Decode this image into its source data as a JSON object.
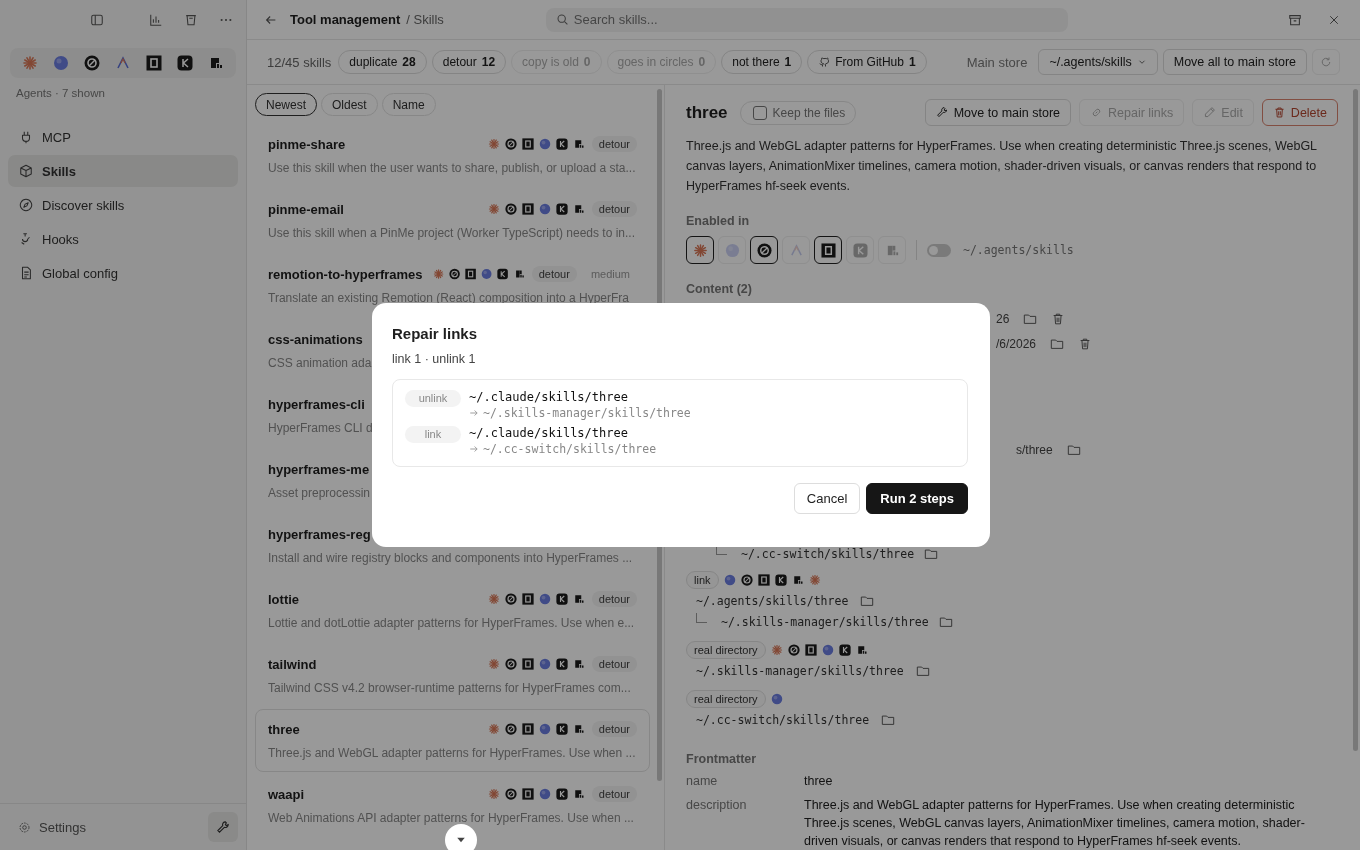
{
  "sidebar": {
    "agents": [
      {
        "kind": "asterisk"
      },
      {
        "kind": "blob"
      },
      {
        "kind": "ring"
      },
      {
        "kind": "chevron"
      },
      {
        "kind": "square"
      },
      {
        "kind": "tile"
      },
      {
        "kind": "pixel"
      }
    ],
    "agents_caption": "Agents · 7 shown",
    "items": [
      {
        "label": "MCP",
        "selected": false
      },
      {
        "label": "Skills",
        "selected": true
      },
      {
        "label": "Discover skills",
        "selected": false
      },
      {
        "label": "Hooks",
        "selected": false
      },
      {
        "label": "Global config",
        "selected": false
      }
    ],
    "settings": "Settings"
  },
  "header": {
    "title": "Tool management",
    "crumb": "/ Skills",
    "search": {
      "placeholder": "Search skills..."
    }
  },
  "toolbar": {
    "count": "12/45 skills",
    "filters": [
      {
        "label": "duplicate",
        "count": "28",
        "disabled": false
      },
      {
        "label": "detour",
        "count": "12",
        "disabled": false
      },
      {
        "label": "copy is old",
        "count": "0",
        "disabled": true
      },
      {
        "label": "goes in circles",
        "count": "0",
        "disabled": true
      },
      {
        "label": "not there",
        "count": "1",
        "disabled": false
      },
      {
        "label": "From GitHub",
        "count": "1",
        "disabled": false,
        "kind": "github"
      }
    ],
    "store_label": "Main store",
    "store_value": "~/.agents/skills",
    "move_all": "Move all to main store"
  },
  "sort": [
    {
      "label": "Newest",
      "selected": true
    },
    {
      "label": "Oldest",
      "selected": false
    },
    {
      "label": "Name",
      "selected": false
    }
  ],
  "skills": [
    {
      "name": "pinme-share",
      "agents": [
        {
          "kind": "asterisk"
        },
        {
          "kind": "ring"
        },
        {
          "kind": "square"
        },
        {
          "kind": "blob"
        },
        {
          "kind": "tile"
        },
        {
          "kind": "pixel"
        }
      ],
      "tags": [
        "detour"
      ],
      "description": "Use this skill when the user wants to share, publish, or upload a sta...",
      "selected": false
    },
    {
      "name": "pinme-email",
      "agents": [
        {
          "kind": "asterisk"
        },
        {
          "kind": "ring"
        },
        {
          "kind": "square"
        },
        {
          "kind": "blob"
        },
        {
          "kind": "tile"
        },
        {
          "kind": "pixel"
        }
      ],
      "tags": [
        "detour"
      ],
      "description": "Use this skill when a PinMe project (Worker TypeScript) needs to in...",
      "selected": false
    },
    {
      "name": "remotion-to-hyperframes",
      "agents": [
        {
          "kind": "asterisk"
        },
        {
          "kind": "ring"
        },
        {
          "kind": "square"
        },
        {
          "kind": "blob"
        },
        {
          "kind": "tile"
        },
        {
          "kind": "pixel"
        }
      ],
      "tags": [
        "detour",
        "medium"
      ],
      "description": "Translate an existing Remotion (React) composition into a HyperFra",
      "selected": false
    },
    {
      "name": "css-animations",
      "description": "CSS animation ada",
      "selected": false
    },
    {
      "name": "hyperframes-cli",
      "description": "HyperFrames CLI d",
      "selected": false
    },
    {
      "name": "hyperframes-me",
      "description": "Asset preprocessin",
      "selected": false
    },
    {
      "name": "hyperframes-reg",
      "description": "Install and wire registry blocks and components into HyperFrames ...",
      "selected": false
    },
    {
      "name": "lottie",
      "agents": [
        {
          "kind": "asterisk"
        },
        {
          "kind": "ring"
        },
        {
          "kind": "square"
        },
        {
          "kind": "blob"
        },
        {
          "kind": "tile"
        },
        {
          "kind": "pixel"
        }
      ],
      "tags": [
        "detour"
      ],
      "description": "Lottie and dotLottie adapter patterns for HyperFrames. Use when e...",
      "selected": false
    },
    {
      "name": "tailwind",
      "agents": [
        {
          "kind": "asterisk"
        },
        {
          "kind": "ring"
        },
        {
          "kind": "square"
        },
        {
          "kind": "blob"
        },
        {
          "kind": "tile"
        },
        {
          "kind": "pixel"
        }
      ],
      "tags": [
        "detour"
      ],
      "description": "Tailwind CSS v4.2 browser-runtime patterns for HyperFrames com...",
      "selected": false
    },
    {
      "name": "three",
      "agents": [
        {
          "kind": "asterisk"
        },
        {
          "kind": "ring"
        },
        {
          "kind": "square"
        },
        {
          "kind": "blob"
        },
        {
          "kind": "tile"
        },
        {
          "kind": "pixel"
        }
      ],
      "tags": [
        "detour"
      ],
      "description": "Three.js and WebGL adapter patterns for HyperFrames. Use when ...",
      "selected": true
    },
    {
      "name": "waapi",
      "agents": [
        {
          "kind": "asterisk"
        },
        {
          "kind": "ring"
        },
        {
          "kind": "square"
        },
        {
          "kind": "blob"
        },
        {
          "kind": "tile"
        },
        {
          "kind": "pixel"
        }
      ],
      "tags": [
        "detour"
      ],
      "description": "Web Animations API adapter patterns for HyperFrames. Use when ...",
      "selected": false
    }
  ],
  "detail": {
    "title": "three",
    "keep_files": {
      "label": "Keep the files",
      "checked": false
    },
    "actions": [
      {
        "label": "Move to main store",
        "disabled": false,
        "kind": "normal"
      },
      {
        "label": "Repair links",
        "disabled": true,
        "kind": "normal"
      },
      {
        "label": "Edit",
        "disabled": true,
        "kind": "normal"
      },
      {
        "label": "Delete",
        "disabled": false,
        "kind": "danger"
      }
    ],
    "description": "Three.js and WebGL adapter patterns for HyperFrames. Use when creating deterministic Three.js scenes, WebGL canvas layers, AnimationMixer timelines, camera motion, shader-driven visuals, or canvas renders that respond to HyperFrames hf-seek events.",
    "enabled_label": "Enabled in",
    "enabled_in": [
      {
        "kind": "asterisk",
        "on": true
      },
      {
        "kind": "blob",
        "on": false
      },
      {
        "kind": "ring",
        "on": true
      },
      {
        "kind": "chevron",
        "on": false
      },
      {
        "kind": "square",
        "on": true
      },
      {
        "kind": "tile",
        "on": false
      },
      {
        "kind": "pixel",
        "on": false
      }
    ],
    "store_toggle": {
      "on": false,
      "label": "~/.agents/skills"
    },
    "content_label": "Content (2)",
    "tails": [
      {
        "text": "26",
        "trash": true
      },
      {
        "text": "/6/2026",
        "trash": true
      },
      {
        "text": "s/three",
        "trash": false
      }
    ],
    "tail_child": "~/.cc-switch/skills/three",
    "groups": [
      {
        "badge": "link",
        "agents": [
          {
            "kind": "blob"
          },
          {
            "kind": "ring"
          },
          {
            "kind": "square"
          },
          {
            "kind": "tile"
          },
          {
            "kind": "pixel"
          },
          {
            "kind": "asterisk"
          }
        ],
        "path": "~/.agents/skills/three",
        "child": "~/.skills-manager/skills/three"
      },
      {
        "badge": "real directory",
        "agents": [
          {
            "kind": "asterisk"
          },
          {
            "kind": "ring"
          },
          {
            "kind": "square"
          },
          {
            "kind": "blob"
          },
          {
            "kind": "tile"
          },
          {
            "kind": "pixel"
          }
        ],
        "path": "~/.skills-manager/skills/three"
      },
      {
        "badge": "real directory",
        "agents": [
          {
            "kind": "blob"
          }
        ],
        "path": "~/.cc-switch/skills/three"
      }
    ],
    "frontmatter_label": "Frontmatter",
    "frontmatter": [
      {
        "key": "name",
        "value": "three"
      },
      {
        "key": "description",
        "value": "Three.js and WebGL adapter patterns for HyperFrames. Use when creating deterministic Three.js scenes, WebGL canvas layers, AnimationMixer timelines, camera motion, shader-driven visuals, or canvas renders that respond to HyperFrames hf-seek events."
      }
    ]
  },
  "dialog": {
    "title": "Repair links",
    "summary": "link 1 · unlink 1",
    "steps": [
      {
        "action": "unlink",
        "source": "~/.claude/skills/three",
        "target": "~/.skills-manager/skills/three"
      },
      {
        "action": "link",
        "source": "~/.claude/skills/three",
        "target": "~/.cc-switch/skills/three"
      }
    ],
    "cancel": "Cancel",
    "confirm": "Run 2 steps"
  }
}
